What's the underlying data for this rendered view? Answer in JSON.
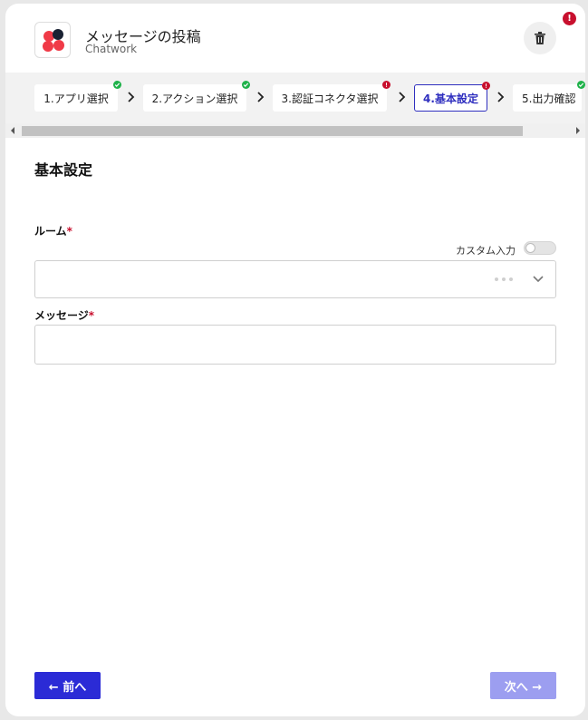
{
  "header": {
    "title": "メッセージの投稿",
    "subtitle": "Chatwork",
    "app_icon": "chatwork-logo",
    "delete_icon": "trash-icon",
    "error_badge": "!"
  },
  "steps": [
    {
      "label": "1.アプリ選択",
      "status": "ok"
    },
    {
      "label": "2.アクション選択",
      "status": "ok"
    },
    {
      "label": "3.認証コネクタ選択",
      "status": "error"
    },
    {
      "label": "4.基本設定",
      "status": "error",
      "active": true
    },
    {
      "label": "5.出力確認",
      "status": "ok"
    }
  ],
  "form": {
    "section_title": "基本設定",
    "room": {
      "label": "ルーム",
      "required_mark": "*",
      "custom_input_label": "カスタム入力",
      "custom_input_enabled": false,
      "value": ""
    },
    "message": {
      "label": "メッセージ",
      "required_mark": "*",
      "value": ""
    }
  },
  "footer": {
    "prev_label": "← 前へ",
    "next_label": "次へ →"
  },
  "colors": {
    "primary": "#2b2bd6",
    "primary_disabled": "#9c9ef0",
    "ok": "#1fb24a",
    "error": "#c8102e"
  }
}
